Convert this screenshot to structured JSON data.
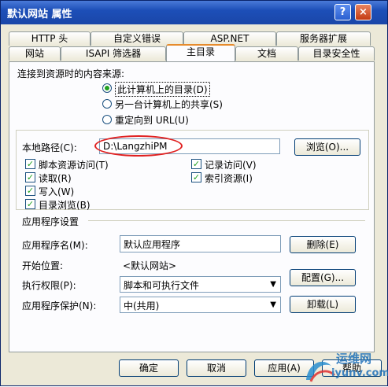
{
  "window": {
    "title": "默认网站 属性",
    "help_label": "?",
    "close_label": "×"
  },
  "tabs_back": [
    "HTTP 头",
    "自定义错误",
    "ASP.NET",
    "服务器扩展"
  ],
  "tabs_front": [
    "网站",
    "ISAPI 筛选器",
    "主目录",
    "文档",
    "目录安全性"
  ],
  "active_tab": "主目录",
  "content_source": {
    "label": "连接到资源时的内容来源:",
    "options": [
      "此计算机上的目录(D)",
      "另一台计算机上的共享(S)",
      "重定向到 URL(U)"
    ],
    "selected": 0
  },
  "local_path": {
    "label": "本地路径(C):",
    "value": "D:\\LangzhiPM",
    "browse_label": "浏览(O)..."
  },
  "checkboxes": [
    {
      "label": "脚本资源访问(T)",
      "checked": true
    },
    {
      "label": "读取(R)",
      "checked": true
    },
    {
      "label": "写入(W)",
      "checked": true
    },
    {
      "label": "目录浏览(B)",
      "checked": true
    },
    {
      "label": "记录访问(V)",
      "checked": true
    },
    {
      "label": "索引资源(I)",
      "checked": true
    }
  ],
  "app_settings": {
    "title": "应用程序设置",
    "app_name_label": "应用程序名(M):",
    "app_name_value": "默认应用程序",
    "remove_label": "删除(E)",
    "start_label": "开始位置:",
    "start_value": "<默认网站>",
    "config_label": "配置(G)...",
    "exec_label": "执行权限(P):",
    "exec_value": "脚本和可执行文件",
    "protect_label": "应用程序保护(N):",
    "protect_value": "中(共用)",
    "unload_label": "卸载(L)"
  },
  "footer": {
    "ok": "确定",
    "cancel": "取消",
    "apply": "应用(A)",
    "help": "帮助"
  },
  "watermark": {
    "line1": "运维网",
    "line2": "iyunv.com"
  },
  "colors": {
    "title_bar": "#1d4fb8",
    "active_tab_accent": "#e68b2c",
    "highlight_circle": "#e02020",
    "check": "#21a121"
  }
}
